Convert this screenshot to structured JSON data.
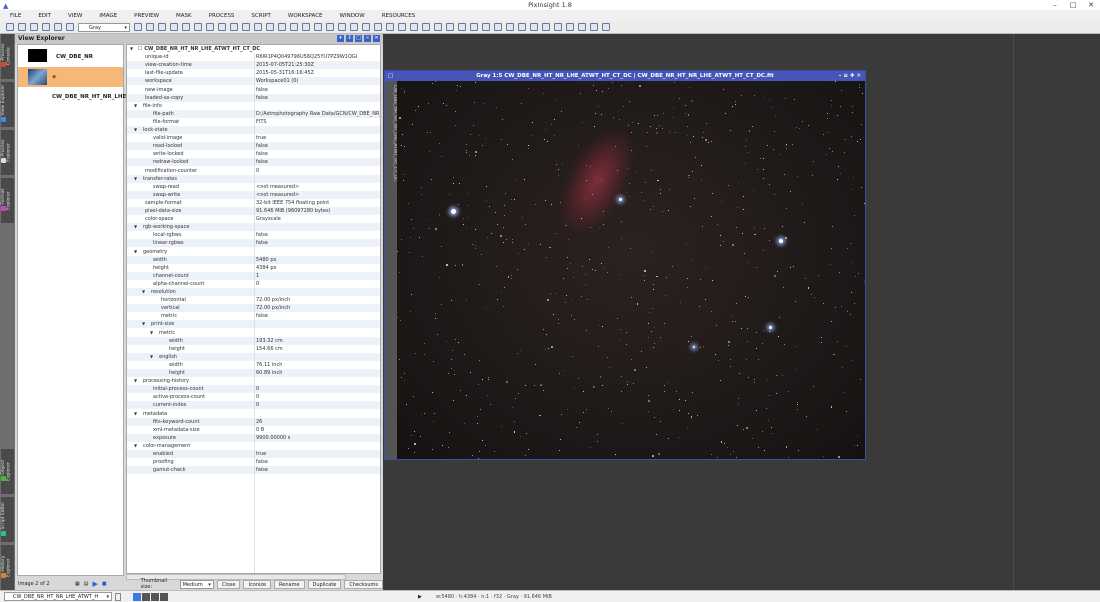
{
  "app": {
    "title": "PixInsight 1.8"
  },
  "menu": [
    "FILE",
    "EDIT",
    "VIEW",
    "IMAGE",
    "PREVIEW",
    "MASK",
    "PROCESS",
    "SCRIPT",
    "WORKSPACE",
    "WINDOW",
    "RESOURCES"
  ],
  "toolbar": {
    "channel_select": "Gray"
  },
  "left_tabs": [
    {
      "label": "Process Console",
      "color": "#e04030"
    },
    {
      "label": "View Explorer",
      "color": "#3b8ee8"
    },
    {
      "label": "Process Explorer",
      "color": "#dddddd"
    },
    {
      "label": "Format Explorer",
      "color": "#d040c0"
    },
    {
      "label": "Object Explorer",
      "color": "#40c030"
    },
    {
      "label": "Script Editor",
      "color": "#20c0a0"
    },
    {
      "label": "History Explorer",
      "color": "#e08020"
    }
  ],
  "view_explorer": {
    "title": "View Explorer",
    "views": [
      {
        "name": "CW_DBE_NR"
      },
      {
        "name": "CW_DBE_NR_HT_NR_LHE..."
      }
    ],
    "root": "CW_DBE_NR_HT_NR_LHE_ATWT_HT_CT_DC",
    "properties": [
      {
        "k": "unique-id",
        "v": "R6IR1P4Q049796U56Q25YU7PZ9W1QGI",
        "l": 1
      },
      {
        "k": "view-creation-time",
        "v": "2015-07-05T21:25:30Z",
        "l": 1
      },
      {
        "k": "last-file-update",
        "v": "2015-05-31T16:16:45Z",
        "l": 1
      },
      {
        "k": "workspace",
        "v": "Workspace01 (0)",
        "l": 1
      },
      {
        "k": "new-image",
        "v": "false",
        "l": 1
      },
      {
        "k": "loaded-as-copy",
        "v": "false",
        "l": 1
      },
      {
        "k": "file-info",
        "v": "",
        "l": 1,
        "g": true
      },
      {
        "k": "file-path",
        "v": "D:/Astrophotography Raw Data/GCN/CW_DBE_NR_HT_",
        "l": 2
      },
      {
        "k": "file-format",
        "v": "FITS",
        "l": 2
      },
      {
        "k": "lock-state",
        "v": "",
        "l": 1,
        "g": true
      },
      {
        "k": "valid-image",
        "v": "true",
        "l": 2
      },
      {
        "k": "read-locked",
        "v": "false",
        "l": 2
      },
      {
        "k": "write-locked",
        "v": "false",
        "l": 2
      },
      {
        "k": "redraw-locked",
        "v": "false",
        "l": 2
      },
      {
        "k": "modification-counter",
        "v": "0",
        "l": 1
      },
      {
        "k": "transfer-rates",
        "v": "",
        "l": 1,
        "g": true
      },
      {
        "k": "swap-read",
        "v": "<not measured>",
        "l": 2
      },
      {
        "k": "swap-write",
        "v": "<not measured>",
        "l": 2
      },
      {
        "k": "sample-format",
        "v": "32-bit IEEE 754 floating point",
        "l": 1
      },
      {
        "k": "pixel-data-size",
        "v": "91.646 MiB (96097280 bytes)",
        "l": 1
      },
      {
        "k": "color-space",
        "v": "Grayscale",
        "l": 1
      },
      {
        "k": "rgb-working-space",
        "v": "",
        "l": 1,
        "g": true
      },
      {
        "k": "local-rgbws",
        "v": "false",
        "l": 2
      },
      {
        "k": "linear-rgbws",
        "v": "false",
        "l": 2
      },
      {
        "k": "geometry",
        "v": "",
        "l": 1,
        "g": true
      },
      {
        "k": "width",
        "v": "5480 px",
        "l": 2
      },
      {
        "k": "height",
        "v": "4384 px",
        "l": 2
      },
      {
        "k": "channel-count",
        "v": "1",
        "l": 2
      },
      {
        "k": "alpha-channel-count",
        "v": "0",
        "l": 2
      },
      {
        "k": "resolution",
        "v": "",
        "l": 2,
        "g": true
      },
      {
        "k": "horizontal",
        "v": "72.00 px/inch",
        "l": 3
      },
      {
        "k": "vertical",
        "v": "72.00 px/inch",
        "l": 3
      },
      {
        "k": "metric",
        "v": "false",
        "l": 3
      },
      {
        "k": "print-size",
        "v": "",
        "l": 2,
        "g": true
      },
      {
        "k": "metric",
        "v": "",
        "l": 3,
        "g": true
      },
      {
        "k": "width",
        "v": "193.32 cm",
        "l": 4
      },
      {
        "k": "height",
        "v": "154.66 cm",
        "l": 4
      },
      {
        "k": "english",
        "v": "",
        "l": 3,
        "g": true
      },
      {
        "k": "width",
        "v": "76.11 inch",
        "l": 4
      },
      {
        "k": "height",
        "v": "60.89 inch",
        "l": 4
      },
      {
        "k": "processing-history",
        "v": "",
        "l": 1,
        "g": true
      },
      {
        "k": "initial-process-count",
        "v": "0",
        "l": 2
      },
      {
        "k": "active-process-count",
        "v": "0",
        "l": 2
      },
      {
        "k": "current-index",
        "v": "0",
        "l": 2
      },
      {
        "k": "metadata",
        "v": "",
        "l": 1,
        "g": true
      },
      {
        "k": "fits-keyword-count",
        "v": "26",
        "l": 2
      },
      {
        "k": "xml-metadata-size",
        "v": "0 B",
        "l": 2
      },
      {
        "k": "exposure",
        "v": "9900.00000 s",
        "l": 2
      },
      {
        "k": "color-management",
        "v": "",
        "l": 1,
        "g": true
      },
      {
        "k": "enabled",
        "v": "true",
        "l": 2
      },
      {
        "k": "proofing",
        "v": "false",
        "l": 2
      },
      {
        "k": "gamut-check",
        "v": "false",
        "l": 2
      }
    ],
    "image_count": "Image 2 of 2",
    "thumbnail_label": "Thumbnail size:",
    "thumbnail_size": "Medium",
    "buttons": [
      "Close",
      "Iconize",
      "Rename",
      "Duplicate",
      "Checksums"
    ]
  },
  "image_window": {
    "title": "Gray 1:5 CW_DBE_NR_HT_NR_LHE_ATWT_HT_CT_DC | CW_DBE_NR_HT_NR_LHE_ATWT_HT_CT_DC.fit",
    "side_label": "CW_DBE_NR_HT_NR_LHE_ATWT_HT_CT_DC"
  },
  "statusbar": {
    "view_select": "CW_DBE_NR_HT_NR_LHE_ATWT_H",
    "info": "w:5480 · h:4384 · n:1 · f32 · Gray · 91.646 MiB"
  },
  "colors": {
    "accent": "#4855b8",
    "selected_view": "#f5b878"
  }
}
